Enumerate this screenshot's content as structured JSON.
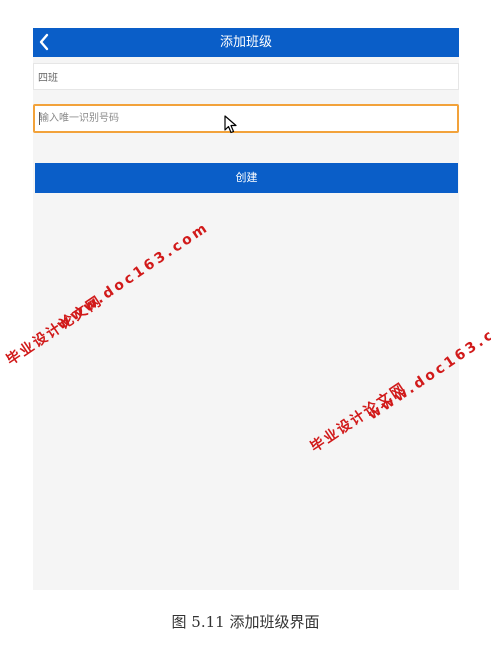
{
  "app": {
    "title": "添加班级",
    "back_icon": "chevron-left-icon"
  },
  "form": {
    "class_name_value": "四班",
    "class_id_placeholder": "输入唯一识别号码",
    "create_label": "创建"
  },
  "watermarks": {
    "site": "www.doc163.com",
    "cn": "毕业设计论文网"
  },
  "caption": "图 5.11 添加班级界面",
  "colors": {
    "header": "#0a5ec8",
    "focus_border": "#f2a23a",
    "watermark": "#d11a1a",
    "background": "#f5f5f5"
  }
}
